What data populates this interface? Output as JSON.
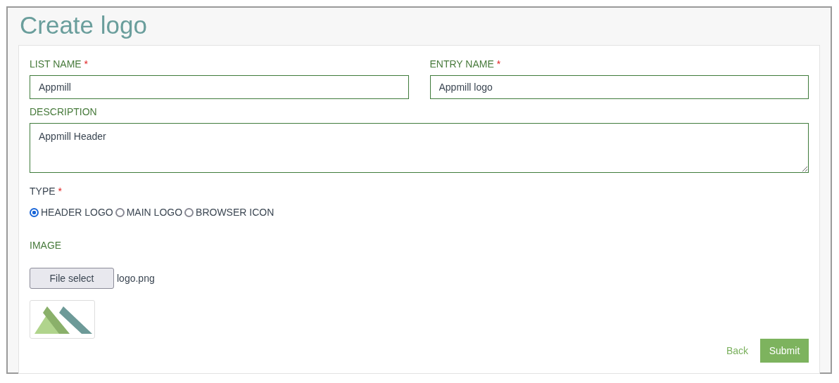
{
  "title": "Create logo",
  "fields": [
    {
      "kind": "input",
      "label": "LIST NAME",
      "required_mark": "*",
      "value": "Appmill"
    },
    {
      "kind": "input",
      "label": "ENTRY NAME",
      "required_mark": "*",
      "value": "Appmill logo"
    },
    {
      "kind": "textarea",
      "label": "DESCRIPTION",
      "value": "Appmill Header"
    }
  ],
  "type": {
    "label": "TYPE",
    "required_mark": "*",
    "options": [
      {
        "label": "HEADER LOGO",
        "selected": true
      },
      {
        "label": "MAIN LOGO",
        "selected": false
      },
      {
        "label": "BROWSER ICON",
        "selected": false
      }
    ]
  },
  "image": {
    "label": "IMAGE",
    "button": "File select",
    "filename": "logo.png"
  },
  "actions": {
    "back": "Back",
    "submit": "Submit"
  }
}
